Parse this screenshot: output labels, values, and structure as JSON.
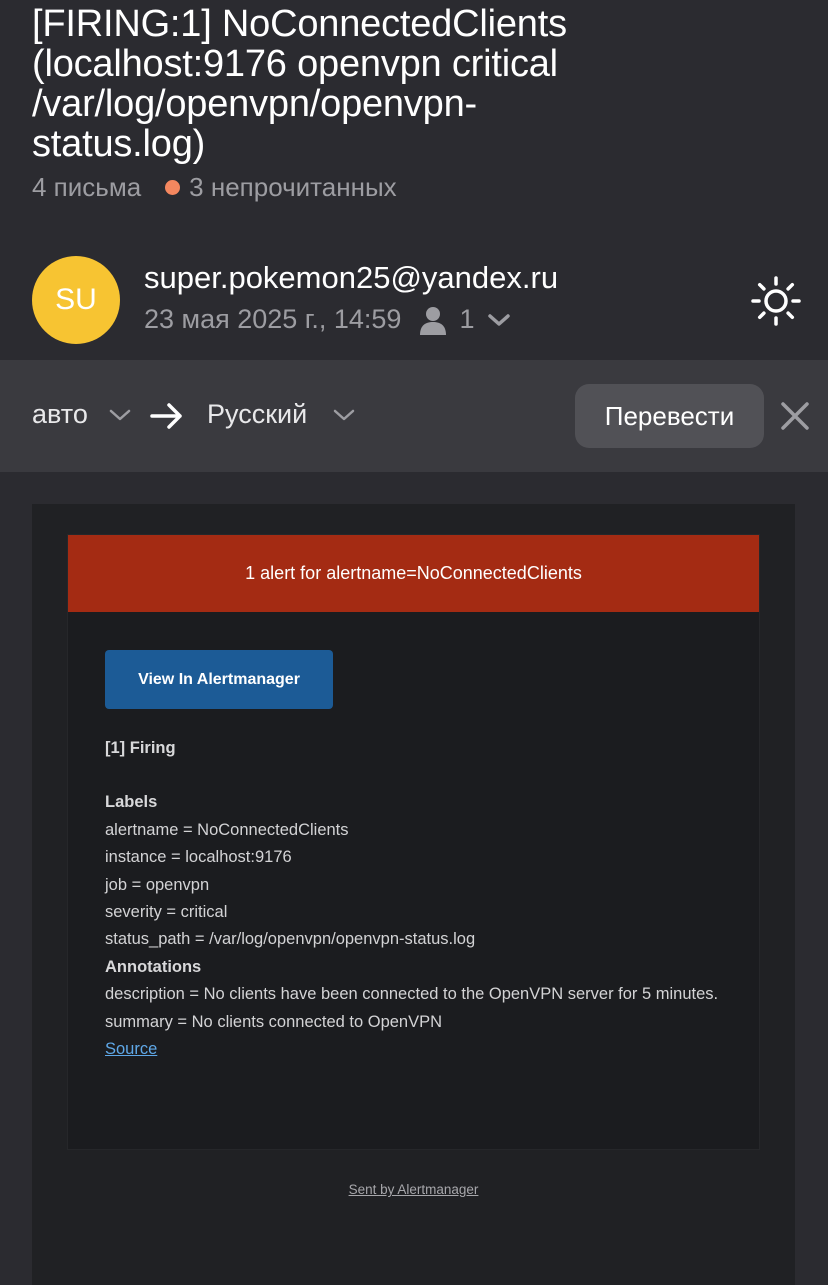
{
  "header": {
    "subject": "[FIRING:1] NoConnectedClients\n(localhost:9176 openvpn critical\n/var/log/openvpn/openvpn-\nstatus.log)",
    "letters_count": "4 письма",
    "unread_count": "3 непрочитанных",
    "unread_dot_color": "#f4875f"
  },
  "sender": {
    "avatar_initials": "SU",
    "avatar_color": "#f7c432",
    "email": "super.pokemon25@yandex.ru",
    "date": "23 мая 2025 г., 14:59",
    "recipients_count": "1",
    "icons": [
      "person-icon",
      "chevron-down-icon",
      "sun-icon"
    ]
  },
  "translate": {
    "source_lang": "авто",
    "target_lang": "Русский",
    "button": "Перевести",
    "icons": [
      "chevron-down-icon",
      "arrow-right-icon",
      "close-icon"
    ]
  },
  "alert": {
    "header": "1 alert for alertname=NoConnectedClients",
    "header_color": "#a42b13",
    "view_button": "View In Alertmanager",
    "view_button_color": "#1c5b96",
    "firing": "[1] Firing",
    "labels_title": "Labels",
    "labels": [
      "alertname = NoConnectedClients",
      "instance = localhost:9176",
      "job = openvpn",
      "severity = critical",
      "status_path = /var/log/openvpn/openvpn-status.log"
    ],
    "annotations_title": "Annotations",
    "annotations": [
      "description = No clients have been connected to the OpenVPN server for 5 minutes.",
      "summary = No clients connected to OpenVPN"
    ],
    "source_link": "Source"
  },
  "footer": {
    "sent_by": "Sent by Alertmanager"
  }
}
